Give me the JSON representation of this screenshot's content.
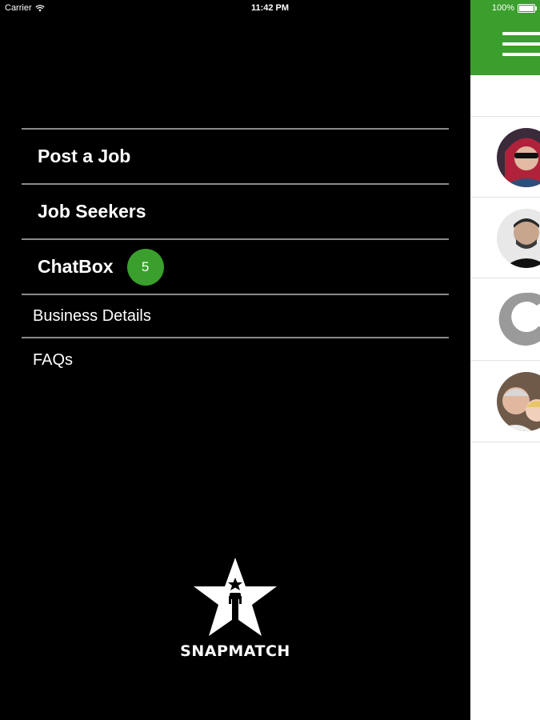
{
  "status_bar": {
    "carrier": "Carrier",
    "time": "11:42 PM",
    "battery": "100%"
  },
  "menu": {
    "post_job": "Post a Job",
    "job_seekers": "Job Seekers",
    "chatbox": "ChatBox",
    "chatbox_badge": "5",
    "business_details": "Business Details",
    "faqs": "FAQs"
  },
  "logo": {
    "text": "SNAPMATCH"
  },
  "colors": {
    "accent_green": "#3a9f2c",
    "drawer_bg": "#000000",
    "divider": "#8a8a8a"
  },
  "icons": {
    "wifi": "wifi-icon",
    "battery": "battery-icon",
    "menu": "hamburger-icon",
    "logo": "star-logo-icon"
  }
}
